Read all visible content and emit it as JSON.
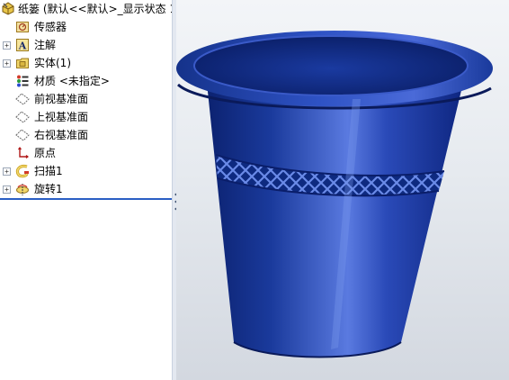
{
  "feature_tree": {
    "root_label": "纸篓  (默认<<默认>_显示状态 1",
    "nodes": [
      {
        "label": "传感器",
        "icon": "sensors-icon",
        "expandable": false
      },
      {
        "label": "注解",
        "icon": "annotations-icon",
        "expandable": true
      },
      {
        "label": "实体(1)",
        "icon": "solid-bodies-icon",
        "expandable": true
      },
      {
        "label": "材质 <未指定>",
        "icon": "material-icon",
        "expandable": false
      },
      {
        "label": "前视基准面",
        "icon": "plane-icon",
        "expandable": false
      },
      {
        "label": "上视基准面",
        "icon": "plane-icon",
        "expandable": false
      },
      {
        "label": "右视基准面",
        "icon": "plane-icon",
        "expandable": false
      },
      {
        "label": "原点",
        "icon": "origin-icon",
        "expandable": false
      },
      {
        "label": "扫描1",
        "icon": "sweep-icon",
        "expandable": true
      },
      {
        "label": "旋转1",
        "icon": "revolve-icon",
        "expandable": true
      }
    ]
  },
  "viewport": {
    "model": "wastebasket-3d-model",
    "model_color": "#1a3a9c"
  }
}
